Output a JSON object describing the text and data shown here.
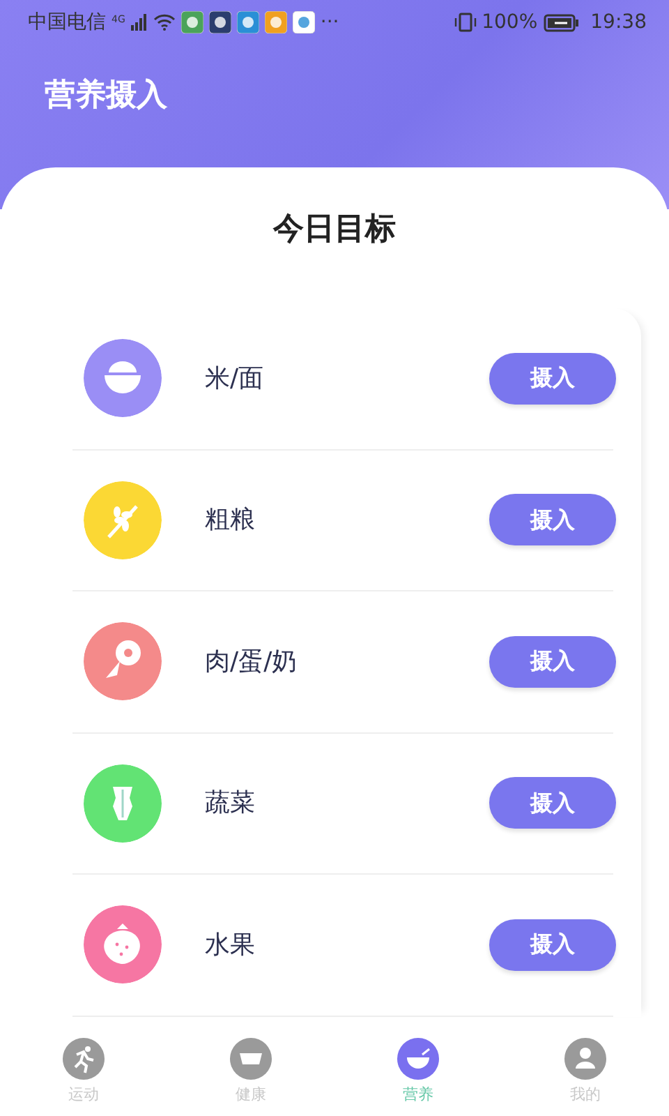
{
  "status_bar": {
    "carrier": "中国电信",
    "network": "4G",
    "more": "···",
    "battery": "100%",
    "time": "19:38"
  },
  "header": {
    "title": "营养摄入"
  },
  "goal_card": {
    "title": "今日目标",
    "items": [
      {
        "kind": "bowl",
        "label": "米/面",
        "color": "#9a8ef5",
        "button": "摄入"
      },
      {
        "kind": "grain",
        "label": "粗粮",
        "color": "#fbd834",
        "button": "摄入"
      },
      {
        "kind": "meat",
        "label": "肉/蛋/奶",
        "color": "#f48a8a",
        "button": "摄入"
      },
      {
        "kind": "vegetable",
        "label": "蔬菜",
        "color": "#62e374",
        "button": "摄入"
      },
      {
        "kind": "fruit",
        "label": "水果",
        "color": "#f676a3",
        "button": "摄入"
      }
    ]
  },
  "tab_bar": [
    {
      "kind": "run",
      "label": "运动",
      "selected": false
    },
    {
      "kind": "scale",
      "label": "健康",
      "selected": false
    },
    {
      "kind": "bowl",
      "label": "营养",
      "selected": true
    },
    {
      "kind": "person",
      "label": "我的",
      "selected": false
    }
  ]
}
